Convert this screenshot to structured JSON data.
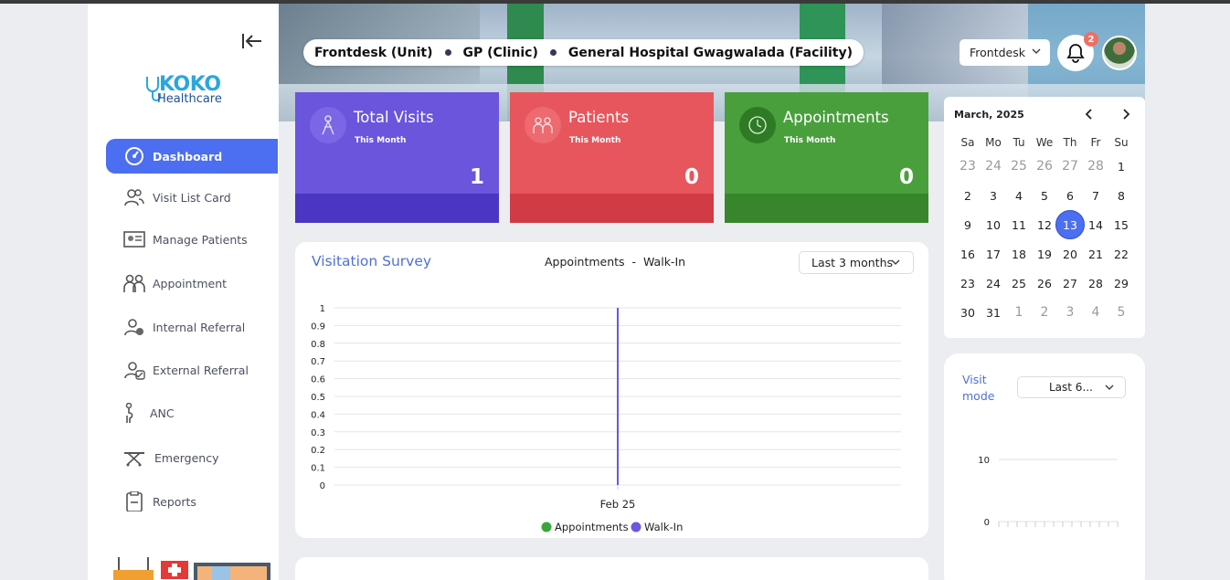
{
  "sidebar": {
    "logo": {
      "brand_a": "KO",
      "brand_b": "KO",
      "subtitle": "Healthcare"
    },
    "items": [
      {
        "label": "Dashboard",
        "icon": "dashboard-icon",
        "active": true
      },
      {
        "label": "Visit List Card",
        "icon": "users-icon"
      },
      {
        "label": "Manage Patients",
        "icon": "patient-card-icon"
      },
      {
        "label": "Appointment",
        "icon": "appointment-icon"
      },
      {
        "label": "Internal Referral",
        "icon": "internal-referral-icon"
      },
      {
        "label": "External Referral",
        "icon": "external-referral-icon"
      },
      {
        "label": "ANC",
        "icon": "pregnant-icon"
      },
      {
        "label": "Emergency",
        "icon": "stretcher-icon"
      },
      {
        "label": "Reports",
        "icon": "clipboard-icon"
      }
    ]
  },
  "header": {
    "breadcrumb": [
      "Frontdesk (Unit)",
      "GP (Clinic)",
      "General Hospital Gwagwalada (Facility)"
    ],
    "role_select": "Frontdesk",
    "notification_count": "2"
  },
  "stats": [
    {
      "title": "Total Visits",
      "subtitle": "This Month",
      "value": "1",
      "color_top": "#6a55dc",
      "color_bottom": "#4a36c2"
    },
    {
      "title": "Patients",
      "subtitle": "This Month",
      "value": "0",
      "color_top": "#e8565d",
      "color_bottom": "#d03b44"
    },
    {
      "title": "Appointments",
      "subtitle": "This Month",
      "value": "0",
      "color_top": "#4a9f3d",
      "color_bottom": "#37862b"
    }
  ],
  "survey": {
    "title": "Visitation Survey",
    "legend_text_a": "Appointments",
    "legend_sep": "-",
    "legend_text_b": "Walk-In",
    "range_select": "Last 3 months"
  },
  "chart_data": {
    "type": "line",
    "categories": [
      "Feb 25"
    ],
    "series": [
      {
        "name": "Appointments",
        "color": "#3aa63a",
        "values": [
          0
        ]
      },
      {
        "name": "Walk-In",
        "color": "#6b57e0",
        "values": [
          1
        ]
      }
    ],
    "y_ticks": [
      "0",
      "0.1",
      "0.2",
      "0.3",
      "0.4",
      "0.5",
      "0.6",
      "0.7",
      "0.8",
      "0.9",
      "1"
    ],
    "ylim": [
      0,
      1
    ],
    "grid": true,
    "legend": "bottom"
  },
  "calendar": {
    "month": "March, 2025",
    "weekdays": [
      "Sa",
      "Mo",
      "Tu",
      "We",
      "Th",
      "Fr",
      "Su"
    ],
    "weeks": [
      [
        "23",
        "24",
        "25",
        "26",
        "27",
        "28",
        "1"
      ],
      [
        "2",
        "3",
        "4",
        "5",
        "6",
        "7",
        "8"
      ],
      [
        "9",
        "10",
        "11",
        "12",
        "13",
        "14",
        "15"
      ],
      [
        "16",
        "17",
        "18",
        "19",
        "20",
        "21",
        "22"
      ],
      [
        "23",
        "24",
        "25",
        "26",
        "27",
        "28",
        "29"
      ],
      [
        "30",
        "31",
        "1",
        "2",
        "3",
        "4",
        "5"
      ]
    ],
    "selected": "13"
  },
  "visit_mode": {
    "title": "Visit mode",
    "range_select": "Last 6...",
    "y_ticks": [
      "10",
      "0"
    ]
  }
}
